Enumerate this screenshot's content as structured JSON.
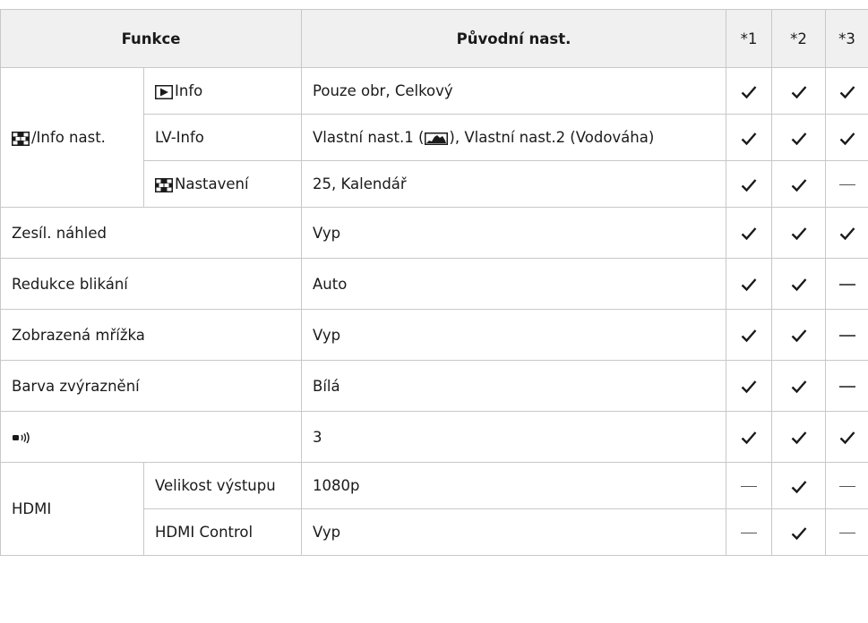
{
  "headers": {
    "funkce": "Funkce",
    "puvodni": "Původní nast.",
    "m1": "*1",
    "m2": "*2",
    "m3": "*3"
  },
  "rows": [
    {
      "group": "/Info nast.",
      "sub": "Info",
      "value": "Pouze obr, Celkový",
      "marks": [
        "check",
        "check",
        "check"
      ]
    },
    {
      "sub": "LV-Info",
      "value_pre": "Vlastní nast.1 (",
      "value_post": "), Vlastní nast.2 (Vodováha)",
      "marks": [
        "check",
        "check",
        "check"
      ]
    },
    {
      "sub": "Nastavení",
      "value": "25, Kalendář",
      "marks": [
        "check",
        "check",
        "dash"
      ]
    },
    {
      "label": "Zesíl. náhled",
      "value": "Vyp",
      "marks": [
        "check",
        "check",
        "check"
      ]
    },
    {
      "label": "Redukce blikání",
      "value": "Auto",
      "marks": [
        "check",
        "check",
        "dash"
      ]
    },
    {
      "label": "Zobrazená mřížka",
      "value": "Vyp",
      "marks": [
        "check",
        "check",
        "dash"
      ]
    },
    {
      "label": "Barva zvýraznění",
      "value": "Bílá",
      "marks": [
        "check",
        "check",
        "dash"
      ]
    },
    {
      "icon": "beep-sound-icon",
      "value": "3",
      "marks": [
        "check",
        "check",
        "check"
      ]
    },
    {
      "group": "HDMI",
      "sub": "Velikost výstupu",
      "value": "1080p",
      "marks": [
        "dash",
        "check",
        "dash"
      ]
    },
    {
      "sub": "HDMI Control",
      "value": "Vyp",
      "marks": [
        "dash",
        "check",
        "dash"
      ]
    }
  ],
  "icons": {
    "grid": "grid-view-icon",
    "play": "playback-icon",
    "histogram": "histogram-icon",
    "beep": "beep-sound-icon",
    "check": "check-icon",
    "dash": "dash-icon"
  }
}
